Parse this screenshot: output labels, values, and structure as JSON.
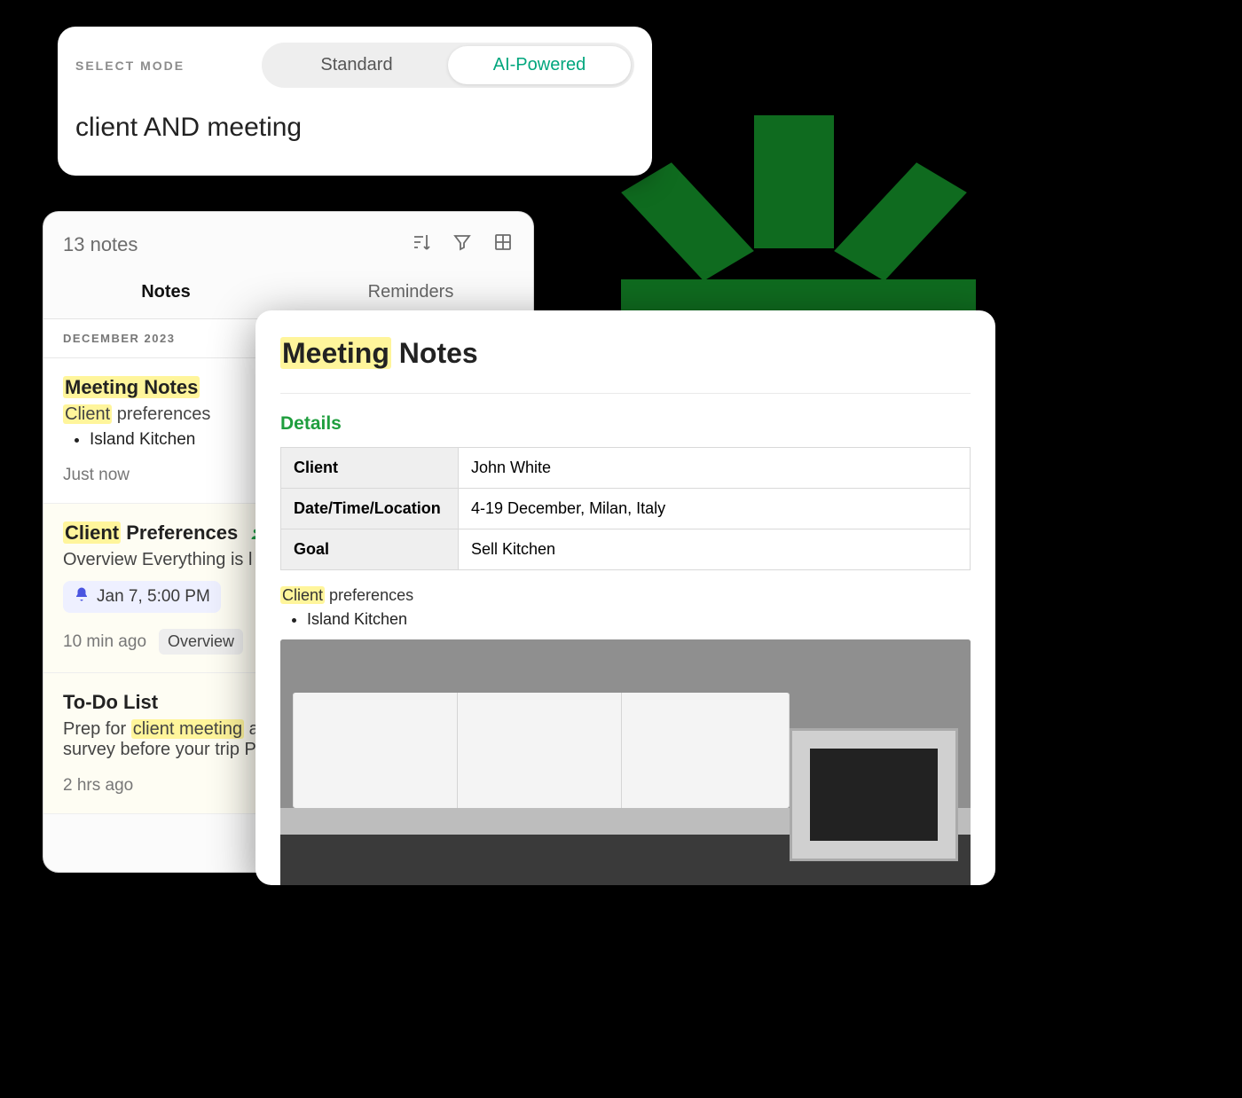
{
  "search": {
    "select_mode_label": "SELECT MODE",
    "options": {
      "standard": "Standard",
      "ai": "AI-Powered"
    },
    "query": "client AND meeting"
  },
  "notes_panel": {
    "count_label": "13 notes",
    "tabs": {
      "notes": "Notes",
      "reminders": "Reminders"
    },
    "section_label": "DECEMBER 2023",
    "items": [
      {
        "title_hl": "Meeting Notes",
        "sub_hl": "Client",
        "sub_rest": " preferences",
        "bullet": "Island Kitchen",
        "time": "Just now"
      },
      {
        "title_hl": "Client",
        "title_rest": " Preferences",
        "shared": true,
        "sub": "Overview Everything is l",
        "reminder": "Jan 7, 5:00 PM",
        "time": "10 min ago",
        "tag": "Overview"
      },
      {
        "title": "To-Do List",
        "sub_pre": "Prep for ",
        "sub_hl": "client meeting",
        "sub_post": " a",
        "sub_line2": "survey before your trip P",
        "time": "2 hrs ago"
      }
    ]
  },
  "detail": {
    "title_hl": "Meeting",
    "title_rest": " Notes",
    "details_heading": "Details",
    "table": {
      "rows": [
        {
          "label": "Client",
          "value": "John White"
        },
        {
          "label": "Date/Time/Location",
          "value": "4-19 December, Milan, Italy"
        },
        {
          "label": "Goal",
          "value": "Sell Kitchen"
        }
      ]
    },
    "prefs_hl": "Client",
    "prefs_rest": " preferences",
    "prefs_bullet": "Island Kitchen"
  }
}
